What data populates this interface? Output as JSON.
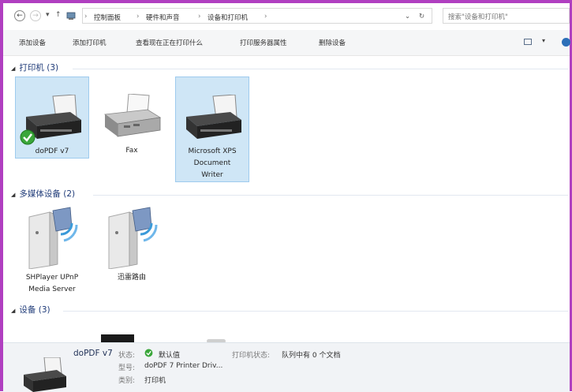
{
  "address": {
    "breadcrumbs": [
      "控制面板",
      "硬件和声音",
      "设备和打印机"
    ],
    "search_placeholder": "搜索\"设备和打印机\""
  },
  "toolbar": {
    "items": [
      "添加设备",
      "添加打印机",
      "查看现在正在打印什么",
      "打印服务器属性",
      "删除设备"
    ]
  },
  "groups": {
    "printers": {
      "header": "打印机 (3)",
      "items": [
        {
          "label": "doPDF v7",
          "icon": "printer-icon",
          "default": true,
          "selected": true
        },
        {
          "label": "Fax",
          "icon": "fax-icon",
          "default": false,
          "selected": false
        },
        {
          "label": "Microsoft XPS Document Writer",
          "icon": "printer-icon",
          "default": false,
          "selected": true
        }
      ]
    },
    "multimedia": {
      "header": "多媒体设备 (2)",
      "items": [
        {
          "label": "SHPlayer UPnP Media Server",
          "icon": "media-server-icon"
        },
        {
          "label": "迅雷路由",
          "icon": "media-server-icon"
        }
      ]
    },
    "devices": {
      "header": "设备 (3)"
    }
  },
  "details": {
    "name": "doPDF v7",
    "status_label": "状态:",
    "status_value": "默认值",
    "model_label": "型号:",
    "model_value": "doPDF 7 Printer Driv...",
    "category_label": "类别:",
    "category_value": "打印机",
    "print_status_label": "打印机状态:",
    "print_status_value": "队列中有 0 个文档"
  },
  "colors": {
    "window_frame": "#b03fc0",
    "selection": "#cfe6f6",
    "header_text": "#1e3a78",
    "default_check": "#3aa63a"
  }
}
